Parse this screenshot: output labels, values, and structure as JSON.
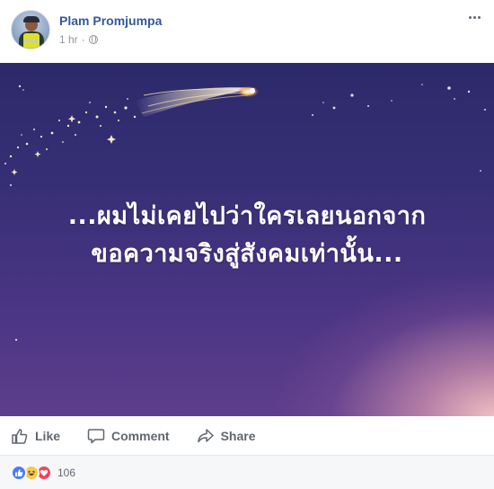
{
  "post": {
    "author": "Plam Promjumpa",
    "timestamp": "1 hr",
    "separator": "·",
    "privacy_icon": "globe-icon",
    "image_text": {
      "line1": "...ผมไม่เคยไปว่าใครเลยนอกจาก",
      "line2": "ขอความจริงสู่สังคมเท่านั้น..."
    }
  },
  "actions": {
    "like": "Like",
    "comment": "Comment",
    "share": "Share"
  },
  "reactions": {
    "types": [
      "like",
      "haha",
      "love"
    ],
    "count": "106"
  },
  "colors": {
    "author_link": "#365899",
    "meta_text": "#90949c",
    "action_text": "#606770",
    "like_blue": "#4a7cf3",
    "haha_yellow": "#f7c948",
    "love_red": "#f0445c"
  }
}
